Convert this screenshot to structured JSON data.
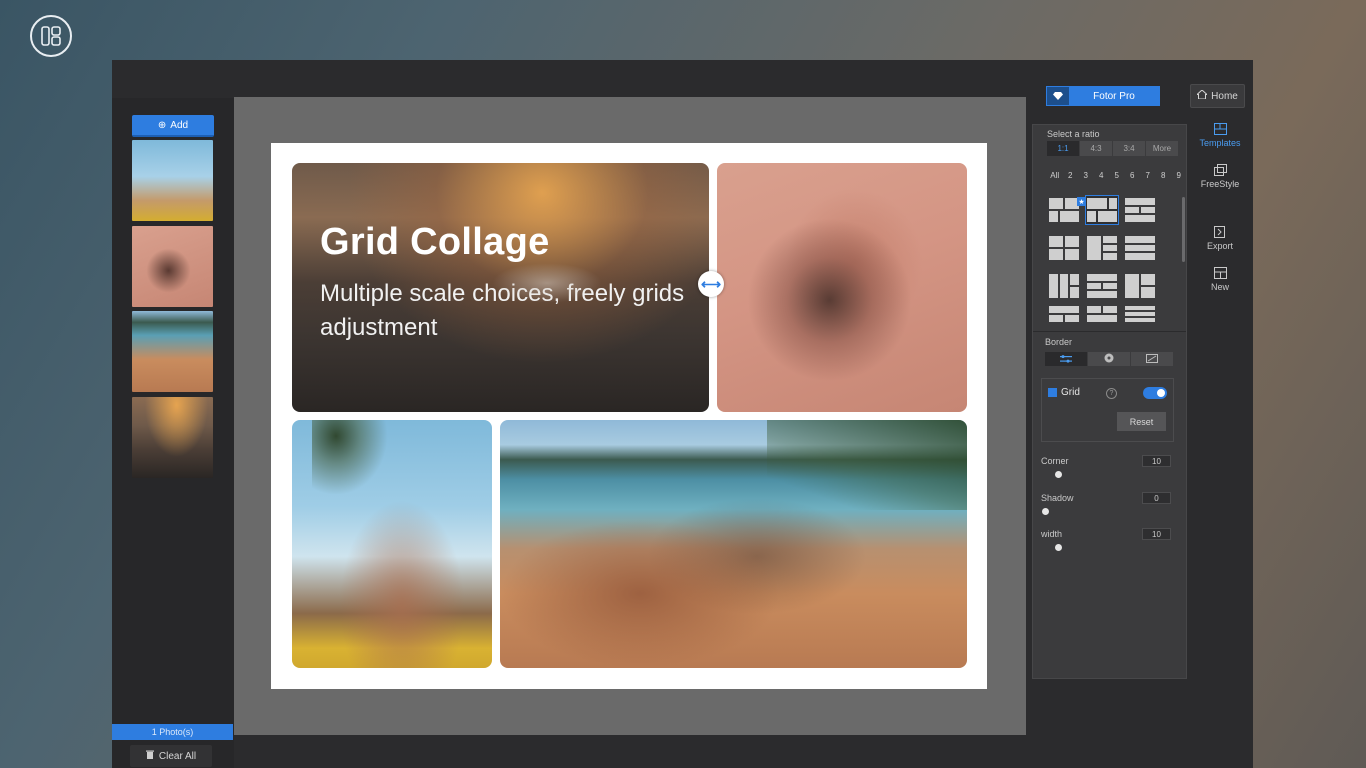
{
  "sidebar": {
    "add_label": "Add",
    "photo_count": "1 Photo(s)",
    "clear_label": "Clear All"
  },
  "canvas": {
    "headline": "Grid Collage",
    "subline": "Multiple scale choices, freely grids adjustment"
  },
  "topbar": {
    "pro_label": "Fotor Pro",
    "home_label": "Home"
  },
  "settings": {
    "ratio_title": "Select a ratio",
    "ratios": [
      "1:1",
      "4:3",
      "3:4",
      "More"
    ],
    "counts": [
      "All",
      "2",
      "3",
      "4",
      "5",
      "6",
      "7",
      "8",
      "9"
    ],
    "border_title": "Border",
    "grid_label": "Grid",
    "grid_enabled": true,
    "help": "?",
    "reset_label": "Reset",
    "corner_label": "Corner",
    "corner_value": "10",
    "shadow_label": "Shadow",
    "shadow_value": "0",
    "width_label": "width",
    "width_value": "10"
  },
  "nav": {
    "templates": "Templates",
    "freestyle": "FreeStyle",
    "export": "Export",
    "new": "New"
  },
  "colors": {
    "accent": "#2e7de0",
    "window_bg": "#2b2b2d",
    "canvas_bg": "#6a6a6a"
  }
}
